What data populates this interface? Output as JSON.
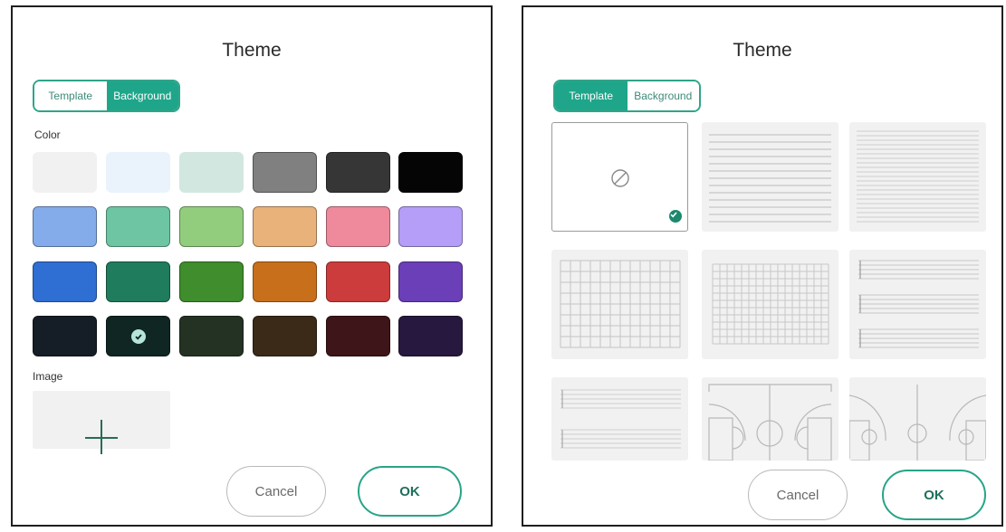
{
  "left_dialog": {
    "title": "Theme",
    "tabs": [
      {
        "label": "Template",
        "active": false
      },
      {
        "label": "Background",
        "active": true
      }
    ],
    "color_label": "Color",
    "image_label": "Image",
    "cancel_label": "Cancel",
    "ok_label": "OK",
    "selected_color": "#0f2623",
    "colors": [
      [
        "#f1f1f1",
        "#eaf3fc",
        "#d2e7df",
        "#808080",
        "#363636",
        "#050505"
      ],
      [
        "#84acea",
        "#6dc5a3",
        "#92cd7e",
        "#e8b27a",
        "#ee8a9c",
        "#b49ef7"
      ],
      [
        "#2f6fd3",
        "#1f7c5d",
        "#3f8d2c",
        "#c86f1c",
        "#cc3c3c",
        "#6a3fb8"
      ],
      [
        "#151d26",
        "#0f2623",
        "#233223",
        "#3b2a18",
        "#3e1518",
        "#27183f"
      ]
    ]
  },
  "right_dialog": {
    "title": "Theme",
    "tabs": [
      {
        "label": "Template",
        "active": true
      },
      {
        "label": "Background",
        "active": false
      }
    ],
    "templates": [
      {
        "name": "none",
        "selected": true
      },
      {
        "name": "lines-wide",
        "selected": false
      },
      {
        "name": "lines-narrow",
        "selected": false
      },
      {
        "name": "grid-large",
        "selected": false
      },
      {
        "name": "grid-small",
        "selected": false
      },
      {
        "name": "music-staff",
        "selected": false
      },
      {
        "name": "music-staff-light",
        "selected": false
      },
      {
        "name": "basketball-half-court",
        "selected": false
      },
      {
        "name": "basketball-court",
        "selected": false
      }
    ],
    "cancel_label": "Cancel",
    "ok_label": "OK"
  },
  "accent_color": "#1fa58a"
}
